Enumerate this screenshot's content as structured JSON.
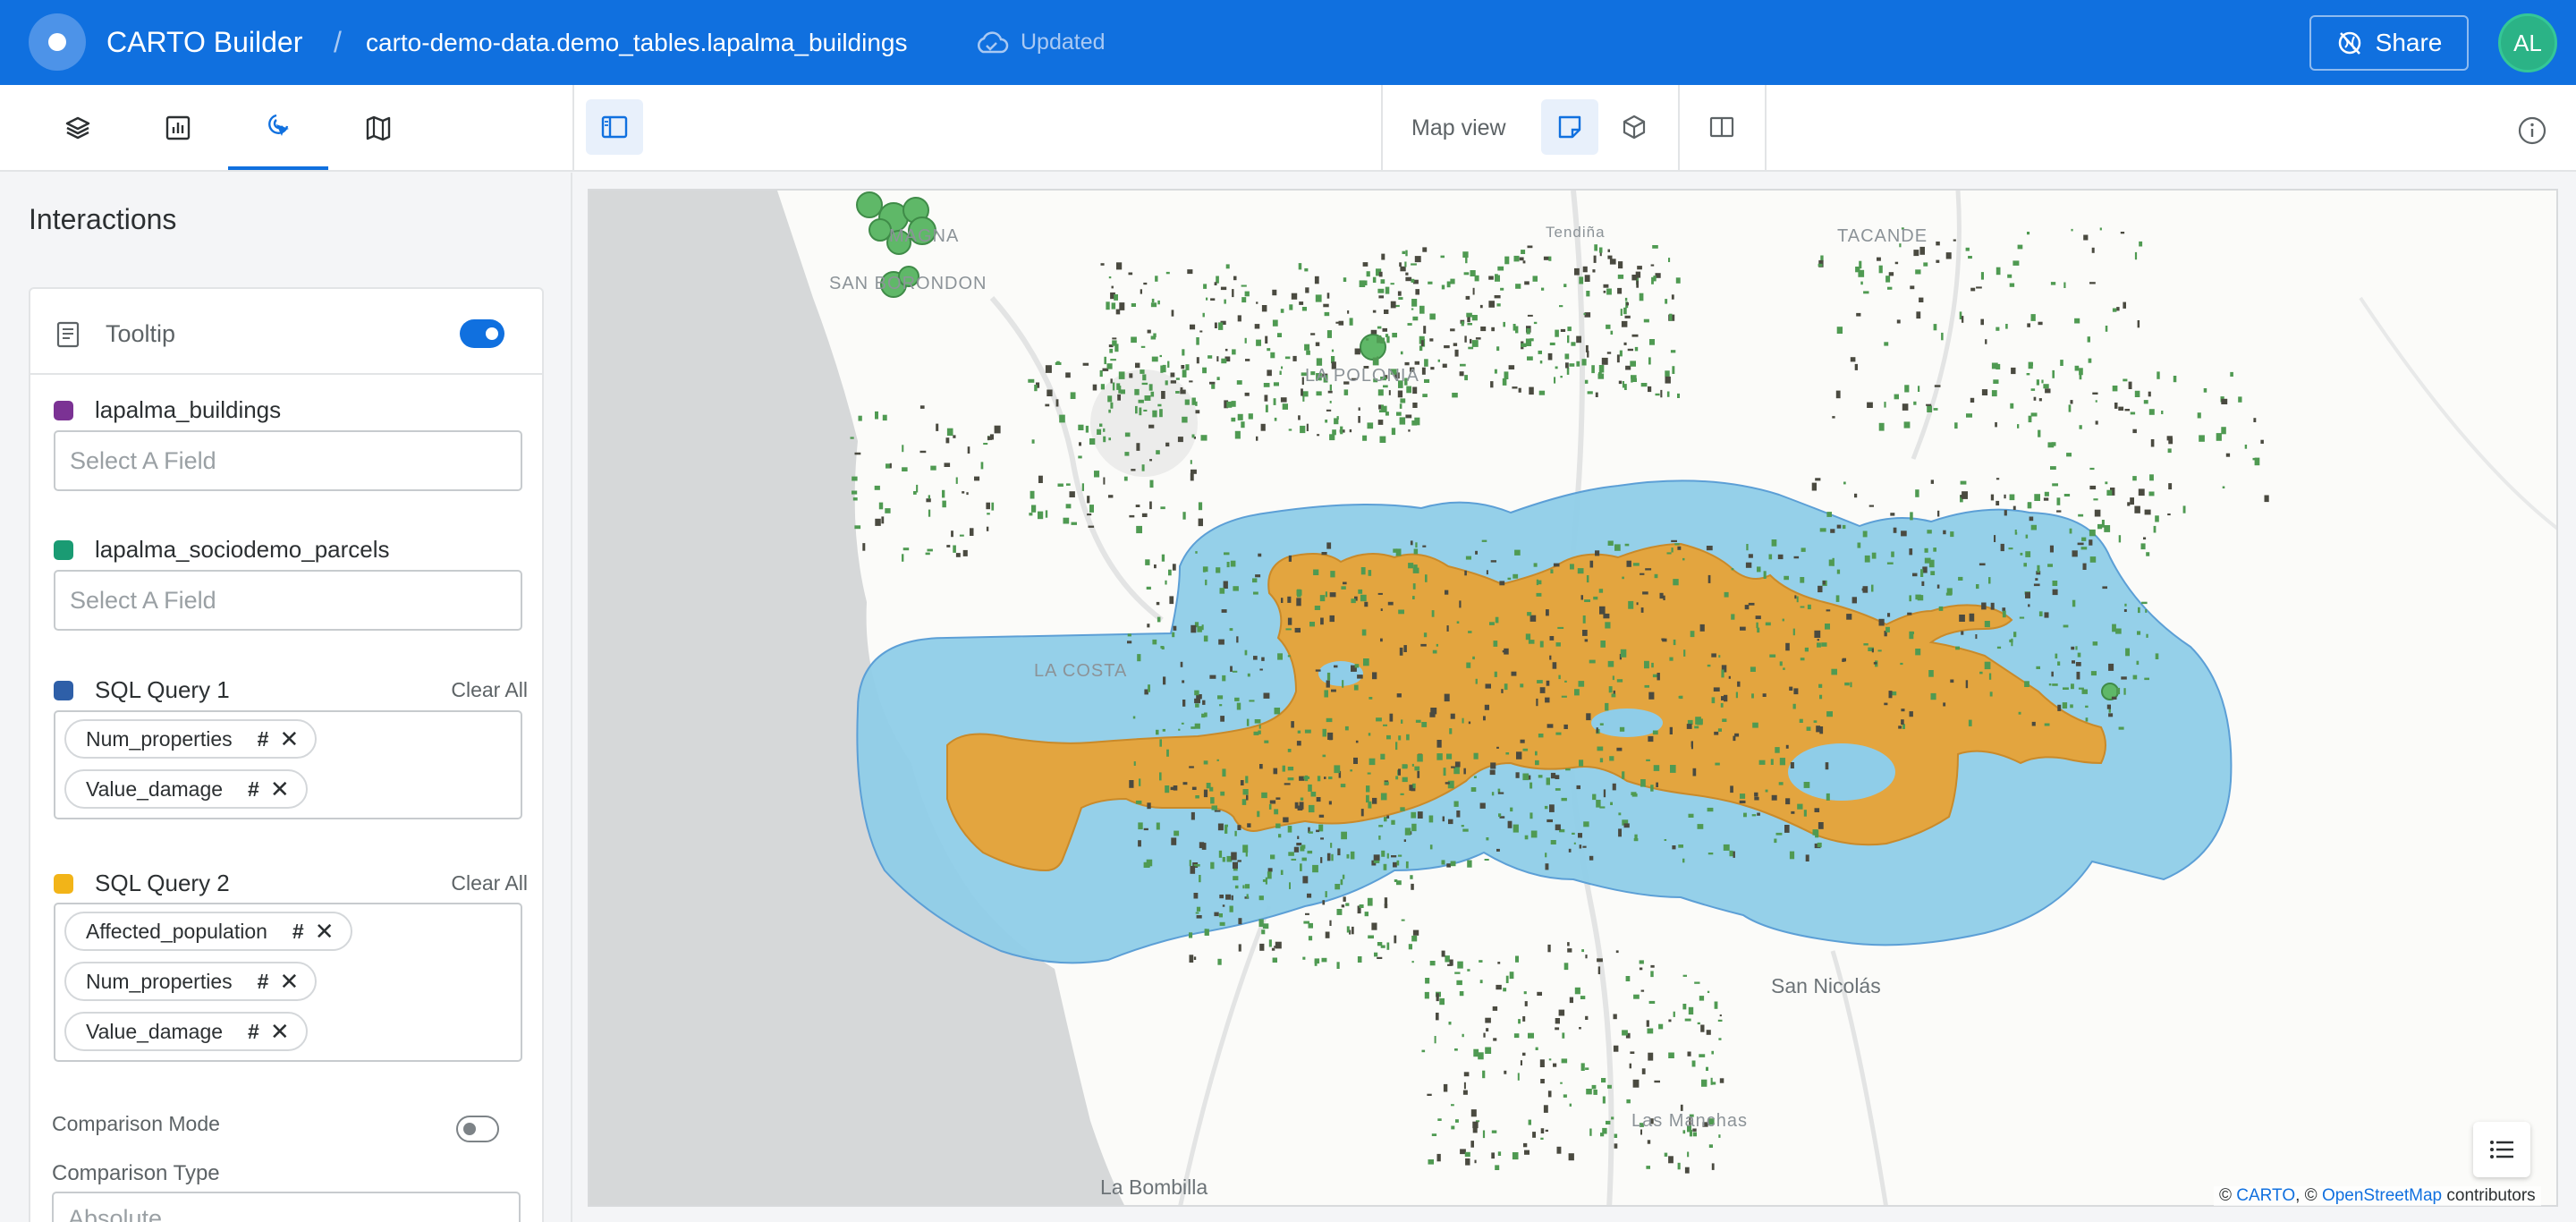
{
  "header": {
    "app_title": "CARTO Builder",
    "separator": "/",
    "dataset": "carto-demo-data.demo_tables.lapalma_buildings",
    "status": "Updated",
    "share_label": "Share",
    "avatar_initials": "AL",
    "brand_color": "#1070df"
  },
  "toolbar": {
    "tabs": [
      {
        "icon": "layers-icon"
      },
      {
        "icon": "widgets-icon"
      },
      {
        "icon": "interactions-icon",
        "active": true
      },
      {
        "icon": "basemap-icon"
      }
    ],
    "map_view_label": "Map view"
  },
  "panel": {
    "title": "Interactions",
    "tooltip_label": "Tooltip",
    "layers": [
      {
        "name": "lapalma_buildings",
        "color": "#7b3294",
        "placeholder": "Select A Field"
      },
      {
        "name": "lapalma_sociodemo_parcels",
        "color": "#1a9b73",
        "placeholder": "Select A Field"
      },
      {
        "name": "SQL Query 1",
        "color": "#2e5fa8",
        "clear": "Clear All",
        "fields": [
          {
            "label": "Num_properties",
            "type": "#"
          },
          {
            "label": "Value_damage",
            "type": "#"
          }
        ]
      },
      {
        "name": "SQL Query 2",
        "color": "#f2b418",
        "clear": "Clear All",
        "fields": [
          {
            "label": "Affected_population",
            "type": "#"
          },
          {
            "label": "Num_properties",
            "type": "#"
          },
          {
            "label": "Value_damage",
            "type": "#"
          }
        ]
      }
    ],
    "comparison_mode_label": "Comparison Mode",
    "comparison_type_label": "Comparison Type",
    "comparison_type_value": "Absolute"
  },
  "map": {
    "places": [
      "MAGNA",
      "SAN BORONDON",
      "Tendiña",
      "TACANDE",
      "LA COSTA",
      "Las Manchas",
      "LA POLONIA",
      "San Nicolás",
      "La Bombilla"
    ],
    "attribution": {
      "prefix": "©",
      "carto": "CARTO",
      "sep": ", ©",
      "osm": "OpenStreetMap",
      "suffix": "contributors"
    },
    "colors": {
      "buffer": "#8fcde8",
      "lava": "#e3a53f",
      "buildings": "#4f9a52",
      "sea": "#d6d8d9"
    }
  }
}
